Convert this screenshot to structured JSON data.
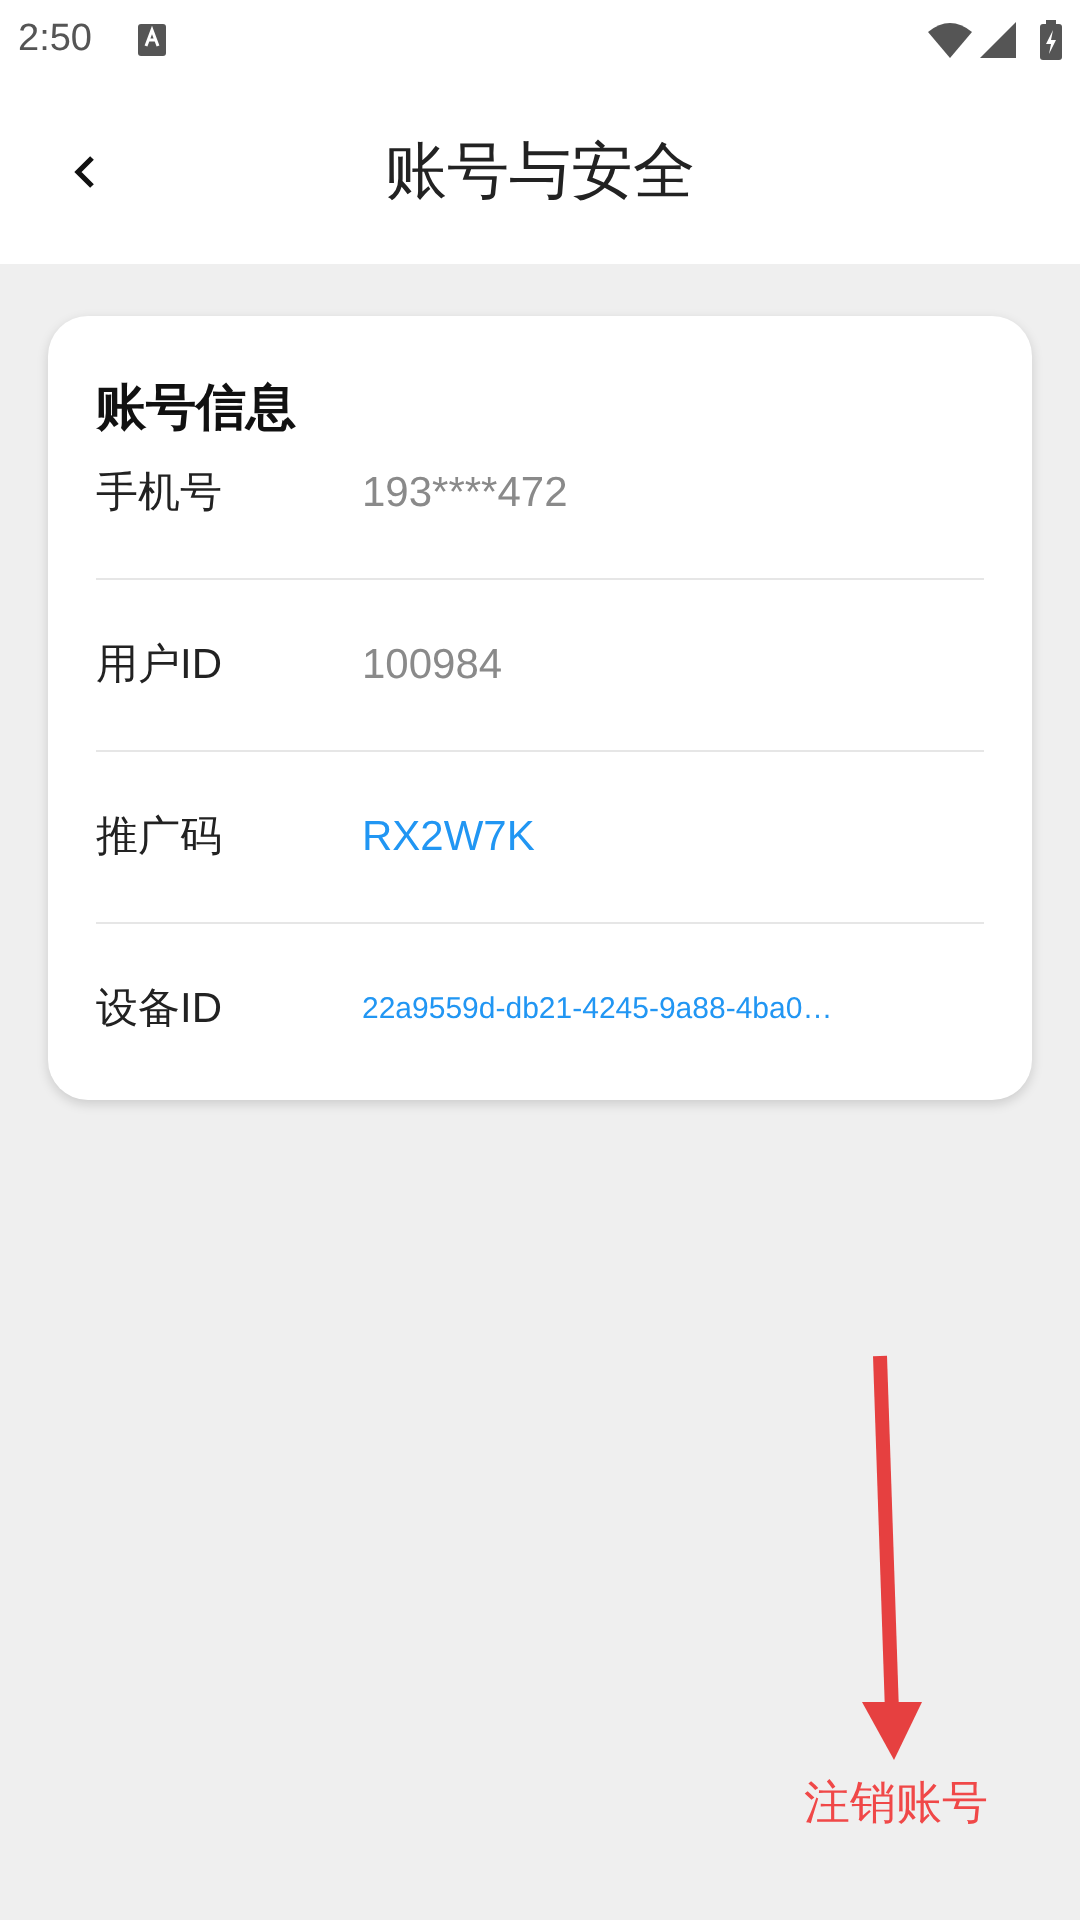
{
  "status_bar": {
    "time": "2:50"
  },
  "header": {
    "title": "账号与安全"
  },
  "card": {
    "title": "账号信息",
    "rows": [
      {
        "label": "手机号",
        "value": "193****472",
        "kind": "plain"
      },
      {
        "label": "用户ID",
        "value": "100984",
        "kind": "plain"
      },
      {
        "label": "推广码",
        "value": "RX2W7K",
        "kind": "link"
      },
      {
        "label": "设备ID",
        "value": "22a9559d-db21-4245-9a88-4ba0…",
        "kind": "code"
      }
    ]
  },
  "annotation": {
    "label": "注销账号"
  }
}
